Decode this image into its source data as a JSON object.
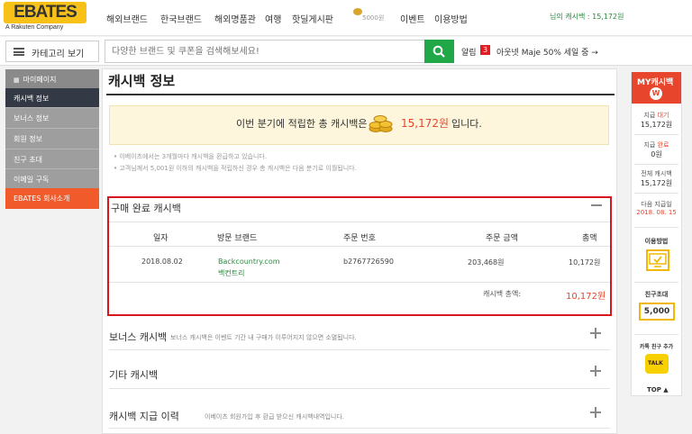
{
  "brand": {
    "logo": "EBATES",
    "sub": "A Rakuten Company"
  },
  "nav": {
    "items": [
      "해외브랜드",
      "한국브랜드",
      "해외명품관",
      "여행",
      "핫딜게시판"
    ],
    "coin_amount": "5000원",
    "event": "이벤트",
    "usage": "이용방법",
    "user_cash": "님의 캐시백 : 15,172원"
  },
  "search": {
    "category": "카테고리 보기",
    "placeholder": "다양한 브랜드 및 쿠폰을 검색해보세요!",
    "alarm": "알림",
    "alarm_count": "3",
    "notice": "아웃넷 Maje 50% 세일 중 →"
  },
  "sidebar": {
    "items": [
      {
        "label": "마이페이지",
        "bg": "#8a8a8a"
      },
      {
        "label": "캐시백 정보",
        "bg": "#333a45"
      },
      {
        "label": "보너스 정보",
        "bg": "#9e9e9e"
      },
      {
        "label": "회원 정보",
        "bg": "#9e9e9e"
      },
      {
        "label": "친구 초대",
        "bg": "#9e9e9e"
      },
      {
        "label": "이메일 구독",
        "bg": "#9e9e9e"
      },
      {
        "label": "EBATES 회사소개",
        "bg": "#f15a2b"
      }
    ]
  },
  "page": {
    "title": "캐시백 정보",
    "banner": {
      "text": "이번 분기에 적립한 총 캐시백은",
      "amount": "15,172원",
      "tail": "입니다."
    },
    "notes": [
      "이베이츠에서는 3개월마다 캐시백을 환급하고 있습니다.",
      "고객님께서 5,001원 이하의 캐시백을 적립하신 경우 총 캐시백은 다음 분기로 이월됩니다."
    ],
    "purchase": {
      "title": "구매 완료 캐시백",
      "headers": [
        "일자",
        "방문 브랜드",
        "주문 번호",
        "주문 금액",
        "총액"
      ],
      "row": {
        "date": "2018.08.02",
        "brand": "Backcountry.com",
        "brand_kr": "백컨트리",
        "order_no": "b2767726590",
        "amount": "203,468원",
        "total": "10,172원"
      },
      "total_label": "캐시백 총액:",
      "total_value": "10,172원"
    },
    "bonus": {
      "title": "보너스 캐시백",
      "desc": "보너스 캐시백은 이벤트 기간 내 구매가 이루어지지 않으면 소멸됩니다."
    },
    "other": {
      "title": "기타 캐시백"
    },
    "payout": {
      "title": "캐시백 지급 이력",
      "desc": "이베이츠 회원가입 후 환급 받으신 캐시백내역입니다."
    }
  },
  "rightpanel": {
    "title": "MY캐시백",
    "w": "W",
    "pending_label_pre": "지급",
    "pending_label_hl": "대기",
    "pending_value": "15,172원",
    "done_label_pre": "지급",
    "done_label_hl": "완료",
    "done_value": "0원",
    "total_label": "전체 캐시백",
    "total_value": "15,172원",
    "next_label": "다음 지급일",
    "next_value": "2018. 08. 15",
    "usage": "이용방법",
    "invite": "친구초대",
    "invite_amount": "5,000",
    "kakao": "카톡 친구 추가",
    "kakao_badge": "TALK",
    "top": "TOP ▲"
  },
  "colors": {
    "accent_red": "#e8452d",
    "search_green": "#20a848",
    "highlight_box": "#d9161f",
    "brand_yellow": "#f7c117"
  }
}
